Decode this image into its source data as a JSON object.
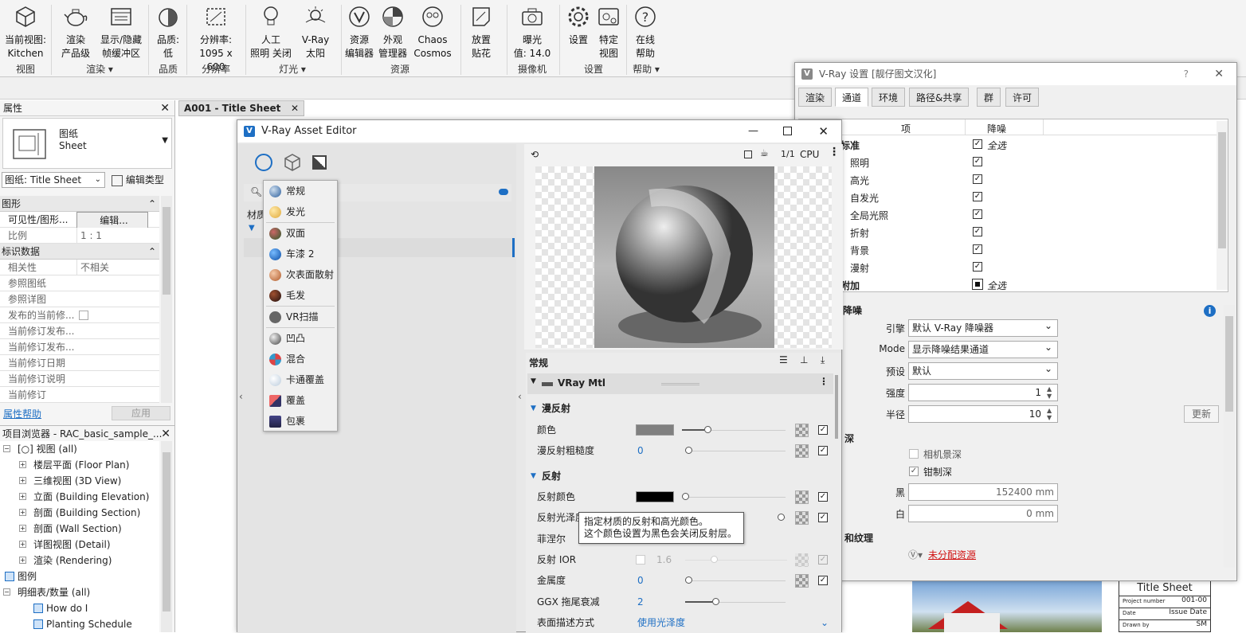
{
  "ribbon": {
    "buttons": [
      {
        "l1": "当前视图:",
        "l2": "Kitchen",
        "icon": "cube-icon"
      },
      {
        "l1": "渲染",
        "l2": "产品级",
        "icon": "teapot-icon"
      },
      {
        "l1": "显示/隐藏",
        "l2": "帧缓冲区",
        "icon": "framebuffer-icon"
      },
      {
        "l1": "品质:",
        "l2": "低",
        "icon": "quality-icon"
      },
      {
        "l1": "分辨率:",
        "l2": "1095 x 600",
        "icon": "resolution-icon"
      },
      {
        "l1": "人工",
        "l2": "照明 关闭",
        "icon": "bulb-icon"
      },
      {
        "l1": "V-Ray",
        "l2": "太阳",
        "icon": "sun-icon"
      },
      {
        "l1": "资源",
        "l2": "编辑器",
        "icon": "vray-logo-icon"
      },
      {
        "l1": "外观",
        "l2": "管理器",
        "icon": "appearance-icon"
      },
      {
        "l1": "Chaos",
        "l2": "Cosmos",
        "icon": "cosmos-icon"
      },
      {
        "l1": "放置",
        "l2": "贴花",
        "icon": "decal-icon"
      },
      {
        "l1": "曝光",
        "l2": "值: 14.0",
        "icon": "camera-icon"
      },
      {
        "l1": "设置",
        "l2": "",
        "icon": "gear-icon"
      },
      {
        "l1": "特定",
        "l2": "视图",
        "icon": "view-icon"
      },
      {
        "l1": "在线",
        "l2": "帮助",
        "icon": "help-icon"
      }
    ],
    "groups": [
      "视图",
      "渲染 ▾",
      "品质",
      "分辨率",
      "灯光 ▾",
      "资源",
      "摄像机",
      "设置",
      "帮助 ▾"
    ]
  },
  "props": {
    "title": "属性",
    "type_l1": "图纸",
    "type_l2": "Sheet",
    "selector": "图纸: Title Sheet",
    "edit_type": "编辑类型",
    "sec1": "图形",
    "vis_label": "可见性/图形...",
    "vis_btn": "编辑...",
    "scale_k": "比例",
    "scale_v": "1 : 1",
    "sec2": "标识数据",
    "rows": [
      {
        "k": "相关性",
        "v": "不相关"
      },
      {
        "k": "参照图纸",
        "v": ""
      },
      {
        "k": "参照详图",
        "v": ""
      },
      {
        "k": "发布的当前修...",
        "v": ""
      },
      {
        "k": "当前修订发布...",
        "v": ""
      },
      {
        "k": "当前修订发布...",
        "v": ""
      },
      {
        "k": "当前修订日期",
        "v": ""
      },
      {
        "k": "当前修订说明",
        "v": ""
      },
      {
        "k": "当前修订",
        "v": ""
      }
    ],
    "help": "属性帮助",
    "apply": "应用"
  },
  "browser": {
    "title": "项目浏览器 - RAC_basic_sample_...",
    "items": [
      {
        "t": "[○] 视图 (all)",
        "lv": 0
      },
      {
        "t": "楼层平面 (Floor Plan)",
        "lv": 1
      },
      {
        "t": "三维视图 (3D View)",
        "lv": 1
      },
      {
        "t": "立面 (Building Elevation)",
        "lv": 1
      },
      {
        "t": "剖面 (Building Section)",
        "lv": 1
      },
      {
        "t": "剖面 (Wall Section)",
        "lv": 1
      },
      {
        "t": "详图视图 (Detail)",
        "lv": 1
      },
      {
        "t": "渲染 (Rendering)",
        "lv": 1
      },
      {
        "t": "图例",
        "lv": 0
      },
      {
        "t": "明细表/数量 (all)",
        "lv": 0
      },
      {
        "t": "How do I",
        "lv": 2
      },
      {
        "t": "Planting Schedule",
        "lv": 2
      }
    ]
  },
  "doc_tab": "A001 - Title Sheet",
  "title_block": {
    "title": "Title Sheet",
    "project_number_label": "Project number",
    "project_number": "001-00",
    "date_label": "Date",
    "date": "Issue Date",
    "drawn_label": "Drawn by",
    "drawn": "SM"
  },
  "vae": {
    "title": "V-Ray Asset Editor",
    "section_label": "材质",
    "menu": [
      "常规",
      "发光",
      "双面",
      "车漆 2",
      "次表面散射",
      "毛发",
      "VR扫描",
      "凹凸",
      "混合",
      "卡通覆盖",
      "覆盖",
      "包裹"
    ],
    "cpu": "CPU",
    "fraction": "1/1",
    "panel_title": "常规",
    "mtl": "VRay Mtl",
    "diffuse": "漫反射",
    "color": "颜色",
    "diffuse_rough": "漫反射粗糙度",
    "diffuse_rough_val": "0",
    "reflection": "反射",
    "refl_color": "反射颜色",
    "refl_gloss": "反射光泽度",
    "fresnel": "菲涅尔",
    "refl_ior": "反射 IOR",
    "refl_ior_val": "1.6",
    "metalness": "金属度",
    "metalness_val": "0",
    "ggx": "GGX 拖尾衰减",
    "ggx_val": "2",
    "surface": "表面描述方式",
    "surface_val": "使用光泽度",
    "tooltip1": "指定材质的反射和高光颜色。",
    "tooltip2": "这个颜色设置为黑色会关闭反射层。"
  },
  "vrs": {
    "title": "V-Ray 设置 [靓仔图文汉化]",
    "tabs": [
      "渲染",
      "通道",
      "环境",
      "路径&共享",
      "群",
      "许可"
    ],
    "col_item": "项",
    "col_denoise": "降噪",
    "group1": "标准",
    "all1": "全选",
    "channels": [
      "照明",
      "高光",
      "自发光",
      "全局光照",
      "折射",
      "背景",
      "漫射"
    ],
    "group2": "附加",
    "all2": "全选",
    "sec_denoise": "降噪",
    "engine_l": "引擎",
    "engine_v": "默认 V-Ray 降噪器",
    "mode_l": "Mode",
    "mode_v": "显示降噪结果通道",
    "preset_l": "预设",
    "preset_v": "默认",
    "strength_l": "强度",
    "strength_v": "1",
    "radius_l": "半径",
    "radius_v": "10",
    "update": "更新",
    "sec_depth": "深",
    "cam_depth": "相机景深",
    "clamp_depth": "钳制深",
    "black_l": "黑",
    "black_v": "152400 mm",
    "white_l": "白",
    "white_v": "0 mm",
    "sec_tex": "和纹理",
    "unassigned": "未分配资源"
  },
  "colors": {
    "accent": "#1e6fc4",
    "link_red": "#d11414"
  }
}
